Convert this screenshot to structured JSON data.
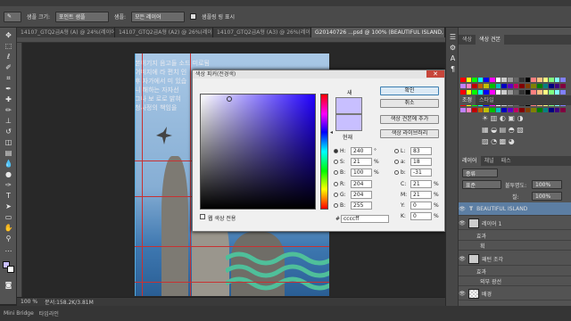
{
  "options_bar": {
    "fields": [
      "샘플 크기:",
      "포인트 샘플",
      "샘플:",
      "모든 레이어",
      "샘플링 링 표시"
    ]
  },
  "tabs": [
    "14107_GTQ2급A형 (A) @ 24%(레이어...",
    "14107_GTQ2급A형 (A2) @ 26%(레이어...",
    "14107_GTQ2급A형 (A3) @ 26%(레이어...",
    "G20140726 ...psd @ 100% (BEAUTIFUL ISLAND, RGB/8)"
  ],
  "document": {
    "text_lines": [
      "본이기지 음고들 소드 미로됨",
      "어미지에 라 편치 인",
      "후 자가에서 미 있습",
      "니 해하는 자자선",
      "그나 보 로로 밝혀",
      "청사정의 책임을"
    ]
  },
  "dialog": {
    "title": "색상 피커(전경색)",
    "new_label": "새",
    "current_label": "현재",
    "new_color": "#c8bfff",
    "current_color": "#c8bfff",
    "buttons": {
      "ok": "확인",
      "cancel": "취소",
      "add_swatch": "색상 견본에 추가",
      "libraries": "색상 라이브러리"
    },
    "web_only": "웹 색상 전용",
    "fields": {
      "H": "240",
      "H_unit": "°",
      "S": "21",
      "S_unit": "%",
      "Bv": "100",
      "Bv_unit": "%",
      "R": "204",
      "G": "204",
      "B": "255",
      "L": "83",
      "a": "18",
      "b": "-31",
      "C": "21",
      "M": "21",
      "Y": "0",
      "K": "0",
      "pct": "%",
      "hex_label": "#",
      "hex": "ccccff"
    },
    "labels": {
      "H": "H:",
      "S": "S:",
      "Bv": "B:",
      "R": "R:",
      "G": "G:",
      "B": "B:",
      "L": "L:",
      "a": "a:",
      "b": "b:",
      "C": "C:",
      "M": "M:",
      "Y": "Y:",
      "K": "K:"
    }
  },
  "status": {
    "zoom": "100 %",
    "doc": "문서:158.2K/3.81M",
    "bottom_left": "Mini Bridge",
    "bottom_right": "타임라인"
  },
  "panels": {
    "swatch_tabs": [
      "색상",
      "색상 견본"
    ],
    "adjust_tabs": [
      "조정",
      "스타일"
    ],
    "layer_tabs": [
      "레이어",
      "채널",
      "패스"
    ],
    "layer_kind": "종류",
    "layer_mode": "표준",
    "opacity_label": "불투명도:",
    "opacity_value": "100%",
    "fill_label": "칠:",
    "fill_value": "100%",
    "layers": [
      {
        "name": "BEAUTIFUL ISLAND",
        "selected": true
      },
      {
        "name": "레이어 1",
        "selected": false
      },
      {
        "name": "효과",
        "selected": false
      },
      {
        "name": "획",
        "selected": false
      },
      {
        "name": "패턴 조각",
        "selected": false
      },
      {
        "name": "효과",
        "selected": false
      },
      {
        "name": "외부 광선",
        "selected": false
      },
      {
        "name": "배경",
        "selected": false
      }
    ]
  }
}
